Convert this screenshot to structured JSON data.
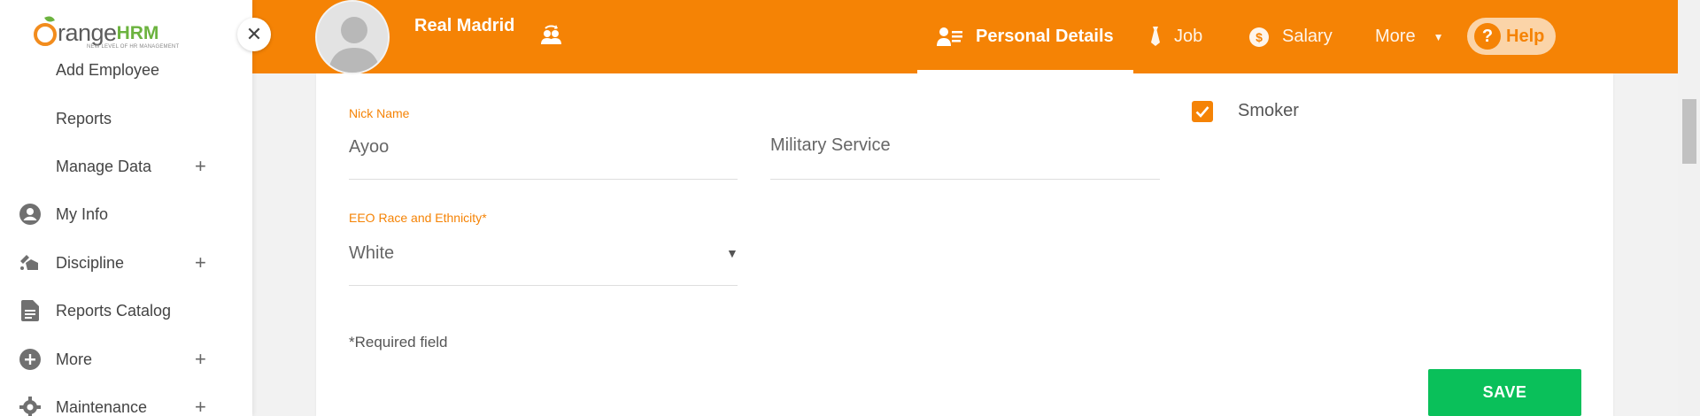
{
  "logo": {
    "text": "range",
    "hrm": "HRM",
    "tagline": "NEW LEVEL OF HR MANAGEMENT"
  },
  "sidebar": {
    "items": [
      {
        "label": "Add Employee",
        "icon": "none",
        "plus": false
      },
      {
        "label": "Reports",
        "icon": "none",
        "plus": false
      },
      {
        "label": "Manage Data",
        "icon": "none",
        "plus": true
      },
      {
        "label": "My Info",
        "icon": "user-circle-icon",
        "plus": false
      },
      {
        "label": "Discipline",
        "icon": "discipline-icon",
        "plus": true
      },
      {
        "label": "Reports Catalog",
        "icon": "document-icon",
        "plus": false
      },
      {
        "label": "More",
        "icon": "plus-circle-icon",
        "plus": true
      },
      {
        "label": "Maintenance",
        "icon": "gear-icon",
        "plus": true
      }
    ],
    "plus_symbol": "+",
    "close_symbol": "✕"
  },
  "header": {
    "employee_name": "Real Madrid",
    "tabs": [
      {
        "label": "Personal Details",
        "icon": "personal-details-icon",
        "active": true
      },
      {
        "label": "Job",
        "icon": "tie-icon",
        "active": false
      },
      {
        "label": "Salary",
        "icon": "dollar-icon",
        "active": false
      },
      {
        "label": "More",
        "icon": "caret-down-icon",
        "active": false
      }
    ],
    "help_label": "Help",
    "help_symbol": "?"
  },
  "form": {
    "nick_name": {
      "label": "Nick Name",
      "value": "Ayoo"
    },
    "military_service": {
      "placeholder": "Military Service"
    },
    "smoker": {
      "label": "Smoker",
      "checked": true
    },
    "eeo_race": {
      "label": "EEO Race and Ethnicity",
      "required_mark": "*",
      "value": "White"
    },
    "required_note": "*Required field",
    "save_label": "SAVE"
  },
  "colors": {
    "brand": "#f58305",
    "save": "#0ac05a",
    "logo_green": "#6cb33f"
  }
}
